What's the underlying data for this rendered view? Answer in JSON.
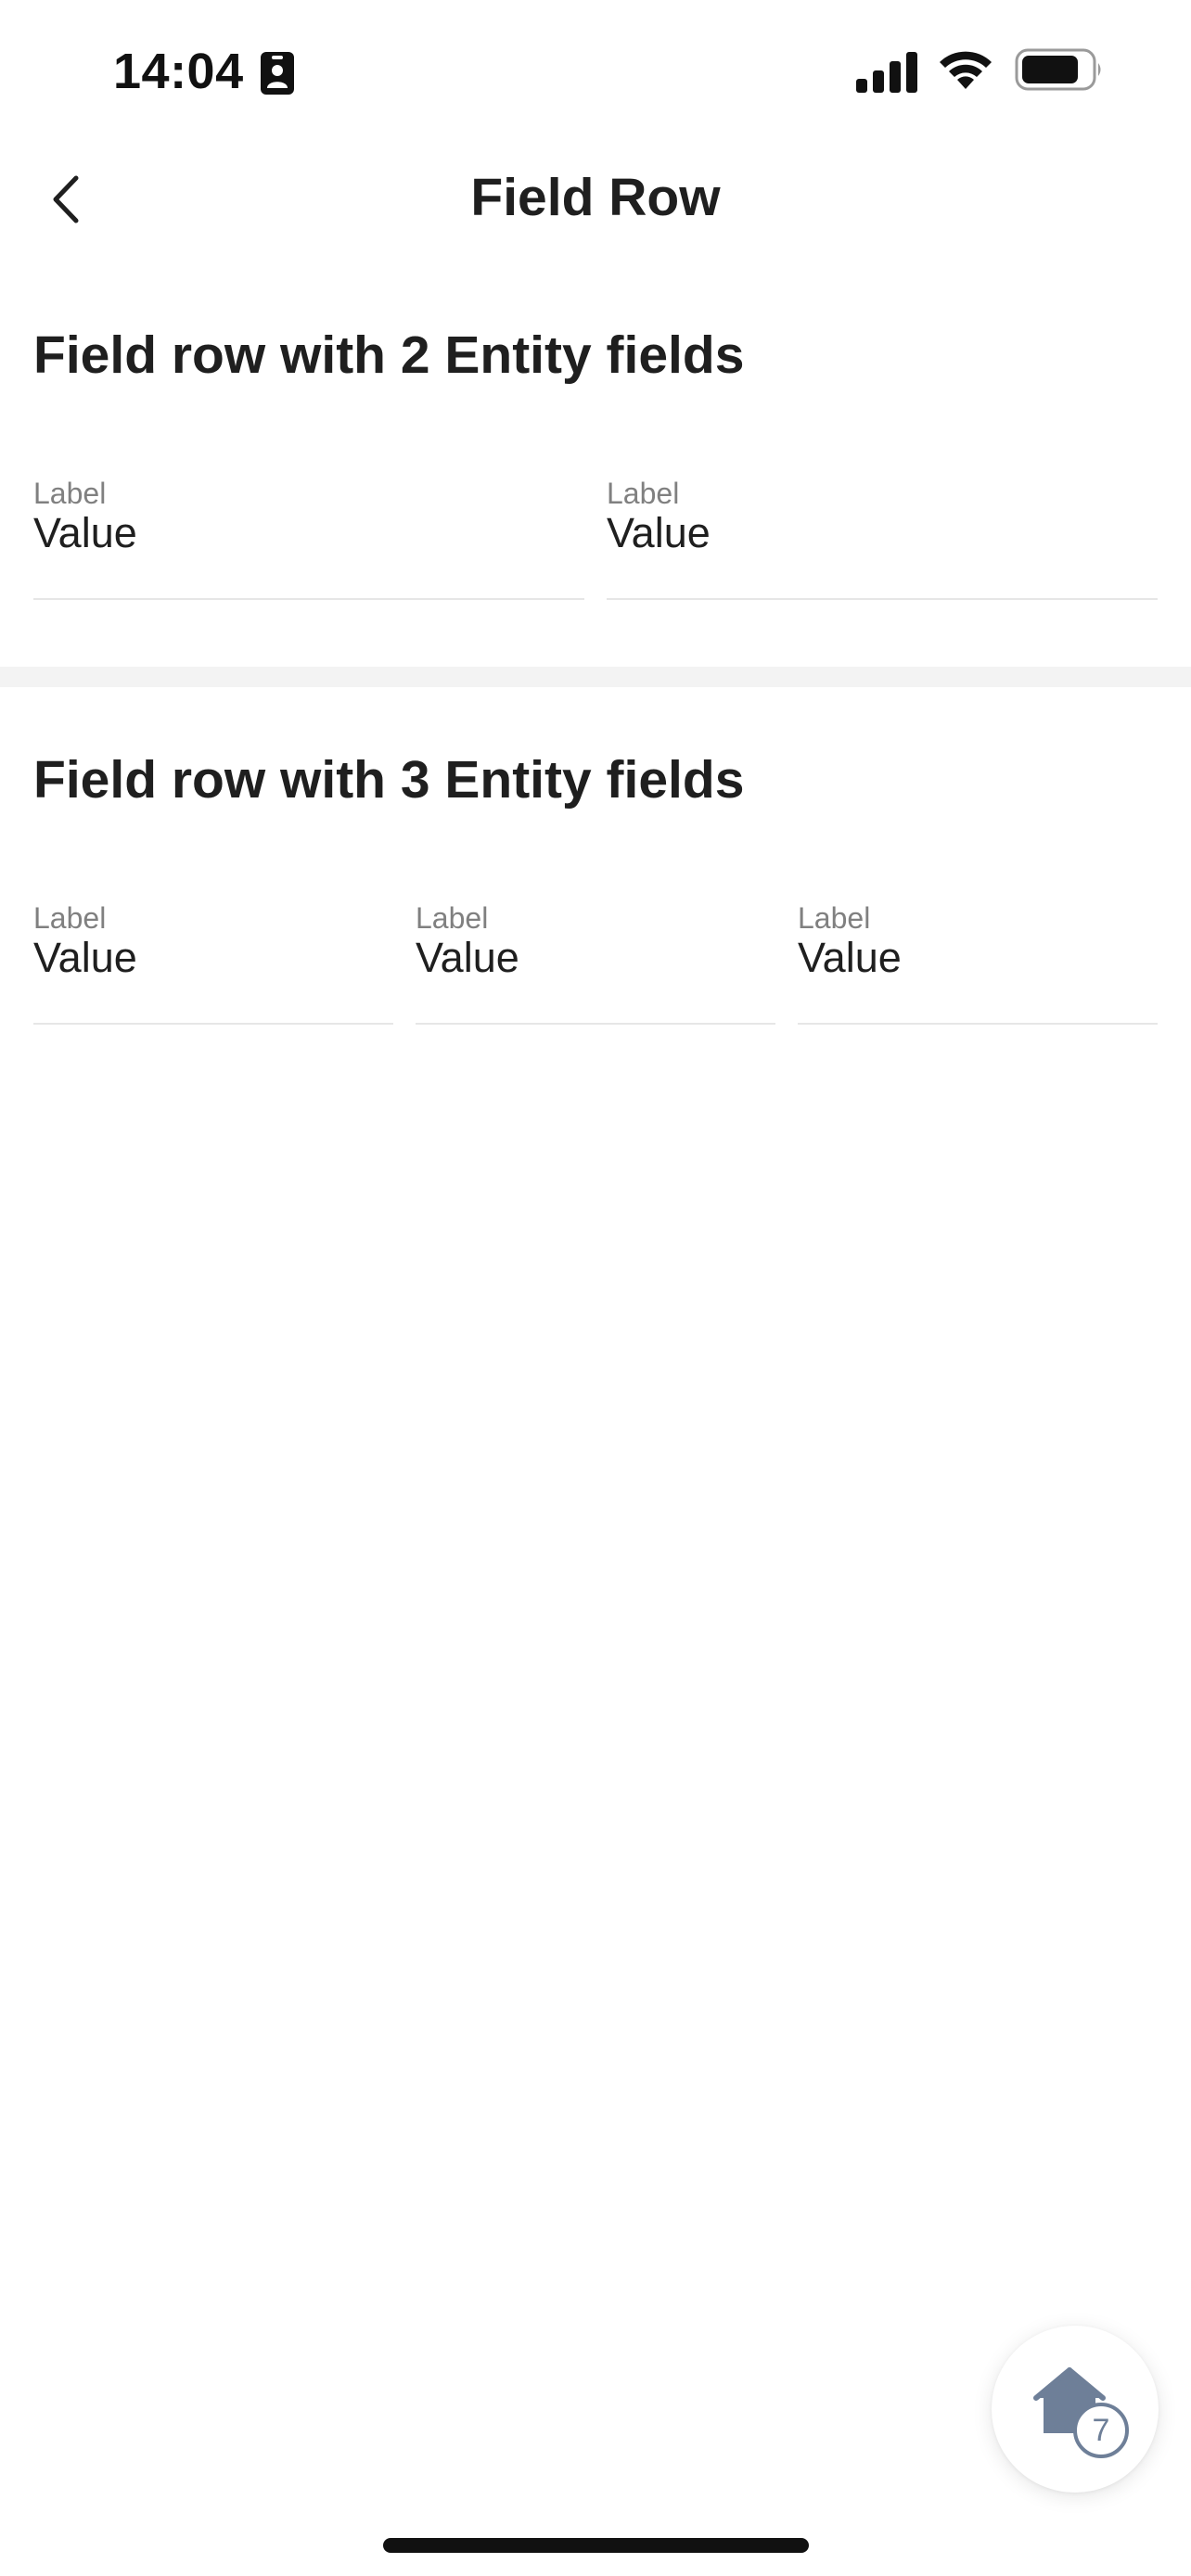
{
  "status_bar": {
    "time": "14:04",
    "icons": [
      "id-badge-icon",
      "cellular-signal-icon",
      "wifi-icon",
      "battery-icon"
    ]
  },
  "nav": {
    "title": "Field Row",
    "back_icon": "chevron-left-icon"
  },
  "sections": [
    {
      "title": "Field row with 2 Entity fields",
      "fields": [
        {
          "label": "Label",
          "value": "Value"
        },
        {
          "label": "Label",
          "value": "Value"
        }
      ]
    },
    {
      "title": "Field row with 3 Entity fields",
      "fields": [
        {
          "label": "Label",
          "value": "Value"
        },
        {
          "label": "Label",
          "value": "Value"
        },
        {
          "label": "Label",
          "value": "Value"
        }
      ]
    }
  ],
  "fab": {
    "icon": "home-icon",
    "badge": "7"
  },
  "colors": {
    "text_primary": "#1f1f1f",
    "text_label": "#808080",
    "divider": "#e6e6e6",
    "section_band": "#f3f3f3",
    "fab_icon": "#6e7f98"
  }
}
